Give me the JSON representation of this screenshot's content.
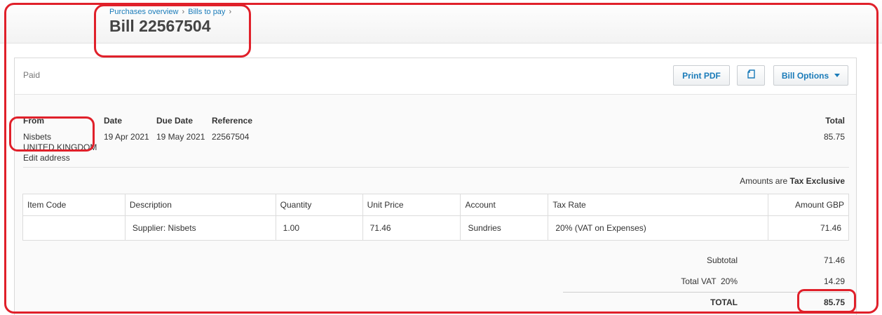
{
  "breadcrumb": {
    "items": [
      "Purchases overview",
      "Bills to pay"
    ],
    "separator": "›"
  },
  "page_title": "Bill 22567504",
  "status": "Paid",
  "toolbar": {
    "print_pdf": "Print PDF",
    "copy_icon": "copy-icon",
    "bill_options": "Bill Options"
  },
  "details": {
    "from_label": "From",
    "from_name": "Nisbets",
    "from_country": "UNITED KINGDOM",
    "edit_address": "Edit address",
    "date_label": "Date",
    "date": "19 Apr 2021",
    "due_date_label": "Due Date",
    "due_date": "19 May 2021",
    "reference_label": "Reference",
    "reference": "22567504",
    "total_label": "Total",
    "total": "85.75"
  },
  "amounts_note": {
    "prefix": "Amounts are",
    "mode": "Tax Exclusive"
  },
  "table": {
    "headers": [
      "Item Code",
      "Description",
      "Quantity",
      "Unit Price",
      "Account",
      "Tax Rate",
      "Amount GBP"
    ],
    "rows": [
      [
        "",
        "Supplier: Nisbets",
        "1.00",
        "71.46",
        "Sundries",
        "20% (VAT on Expenses)",
        "71.46"
      ]
    ]
  },
  "totals": {
    "subtotal_label": "Subtotal",
    "subtotal": "71.46",
    "vat_label": "Total VAT  20%",
    "vat": "14.29",
    "total_label": "TOTAL",
    "total": "85.75"
  },
  "colors": {
    "link": "#1a7bb9",
    "annotation": "#e0202a"
  }
}
